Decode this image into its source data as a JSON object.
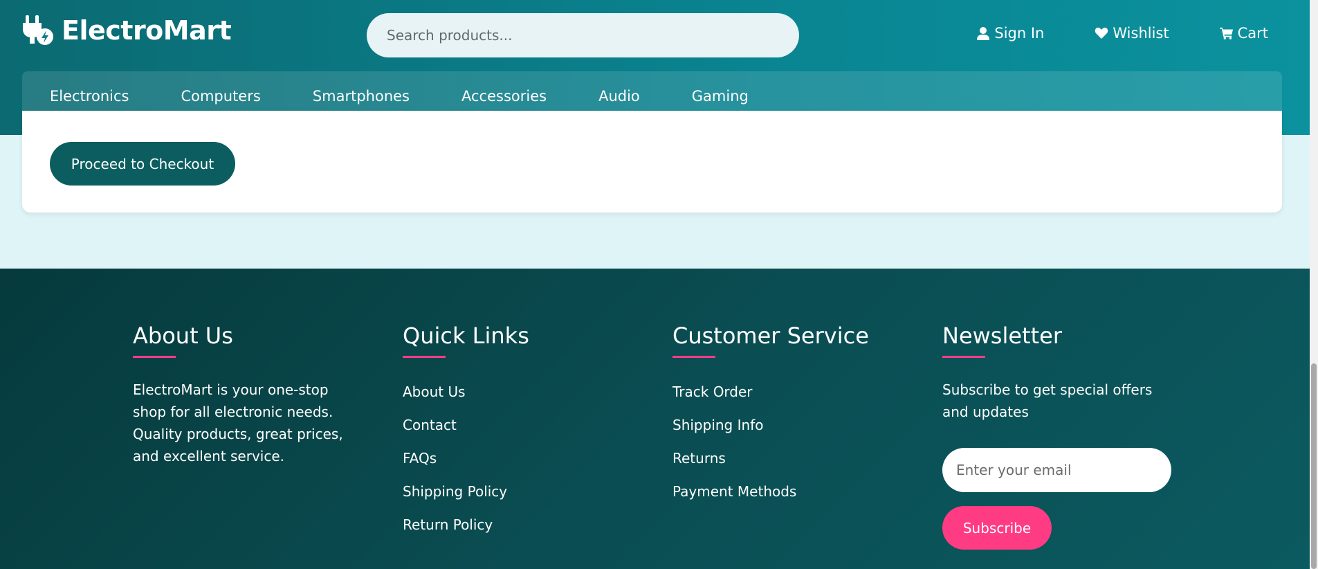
{
  "header": {
    "logo_text": "ElectroMart",
    "search_placeholder": "Search products...",
    "links": {
      "sign_in": "Sign In",
      "wishlist": "Wishlist",
      "cart": "Cart"
    }
  },
  "category_nav": [
    "Electronics",
    "Computers",
    "Smartphones",
    "Accessories",
    "Audio",
    "Gaming"
  ],
  "cart_card": {
    "checkout_label": "Proceed to Checkout"
  },
  "footer": {
    "about": {
      "title": "About Us",
      "text": "ElectroMart is your one-stop shop for all electronic needs. Quality products, great prices, and excellent service."
    },
    "quick_links": {
      "title": "Quick Links",
      "items": [
        "About Us",
        "Contact",
        "FAQs",
        "Shipping Policy",
        "Return Policy"
      ]
    },
    "customer_service": {
      "title": "Customer Service",
      "items": [
        "Track Order",
        "Shipping Info",
        "Returns",
        "Payment Methods"
      ]
    },
    "newsletter": {
      "title": "Newsletter",
      "text": "Subscribe to get special offers and updates",
      "email_placeholder": "Enter your email",
      "subscribe_label": "Subscribe"
    }
  },
  "colors": {
    "header_teal": "#0a8592",
    "checkout_button": "#0b5d5f",
    "accent_pink": "#ff3b84",
    "footer_dark": "#063a3c",
    "page_bg": "#dff4f7"
  },
  "icons": [
    "plug-bolt-logo-icon",
    "user-icon",
    "heart-icon",
    "cart-icon"
  ]
}
